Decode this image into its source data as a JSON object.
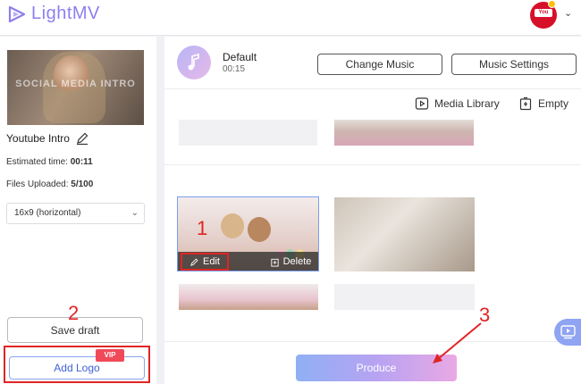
{
  "app": {
    "brand": "LightMV"
  },
  "user": {
    "badge": "You Tube"
  },
  "project": {
    "thumbnail_text": "SOCIAL MEDIA INTRO",
    "name": "Youtube Intro",
    "estimated_label": "Estimated time: ",
    "estimated_value": "00:11",
    "files_label": "Files Uploaded: ",
    "files_value": "5/100",
    "ratio": "16x9 (horizontal)"
  },
  "actions": {
    "save_draft": "Save draft",
    "add_logo": "Add Logo",
    "vip": "VIP",
    "produce": "Produce"
  },
  "music": {
    "name": "Default",
    "duration": "00:15",
    "change_label": "Change Music",
    "settings_label": "Music Settings"
  },
  "toolbar": {
    "media_library": "Media Library",
    "empty": "Empty"
  },
  "tile_actions": {
    "edit": "Edit",
    "delete": "Delete"
  },
  "callouts": [
    "1",
    "2",
    "3"
  ],
  "colors": {
    "brand": "#8d7ff0",
    "annotation_red": "#e02424",
    "link_blue": "#3f62da",
    "vip_red": "#f0495a"
  }
}
